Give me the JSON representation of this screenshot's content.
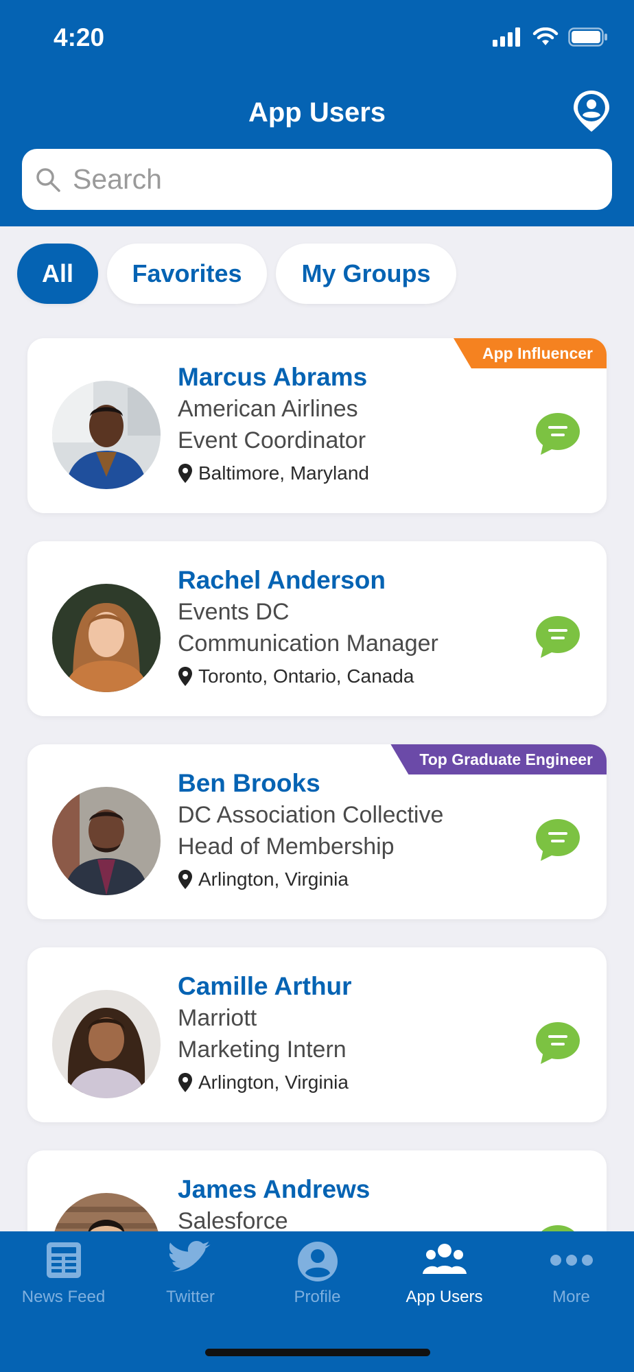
{
  "status_bar": {
    "time": "4:20"
  },
  "header": {
    "title": "App Users"
  },
  "search": {
    "placeholder": "Search",
    "value": ""
  },
  "filters": [
    {
      "label": "All",
      "active": true
    },
    {
      "label": "Favorites",
      "active": false
    },
    {
      "label": "My Groups",
      "active": false
    }
  ],
  "users": [
    {
      "name": "Marcus Abrams",
      "company": "American Airlines",
      "role": "Event Coordinator",
      "location": "Baltimore, Maryland",
      "badge": "App Influencer",
      "badge_color": "#f58220"
    },
    {
      "name": "Rachel Anderson",
      "company": "Events DC",
      "role": "Communication Manager",
      "location": "Toronto, Ontario, Canada",
      "badge": "",
      "badge_color": ""
    },
    {
      "name": "Ben Brooks",
      "company": "DC Association Collective",
      "role": "Head of Membership",
      "location": "Arlington, Virginia",
      "badge": "Top Graduate Engineer",
      "badge_color": "#6b4aa8"
    },
    {
      "name": "Camille Arthur",
      "company": "Marriott",
      "role": "Marketing Intern",
      "location": "Arlington, Virginia",
      "badge": "",
      "badge_color": ""
    },
    {
      "name": "James Andrews",
      "company": "Salesforce",
      "role": "",
      "location": "",
      "badge": "",
      "badge_color": ""
    }
  ],
  "tabs": [
    {
      "label": "News Feed",
      "icon": "newspaper-icon",
      "active": false
    },
    {
      "label": "Twitter",
      "icon": "twitter-bird-icon",
      "active": false
    },
    {
      "label": "Profile",
      "icon": "user-circle-icon",
      "active": false
    },
    {
      "label": "App Users",
      "icon": "users-group-icon",
      "active": true
    },
    {
      "label": "More",
      "icon": "more-dots-icon",
      "active": false
    }
  ],
  "colors": {
    "brand_blue": "#0563b3",
    "chat_green": "#7cc242",
    "influencer_orange": "#f58220",
    "engineer_purple": "#6b4aa8"
  }
}
